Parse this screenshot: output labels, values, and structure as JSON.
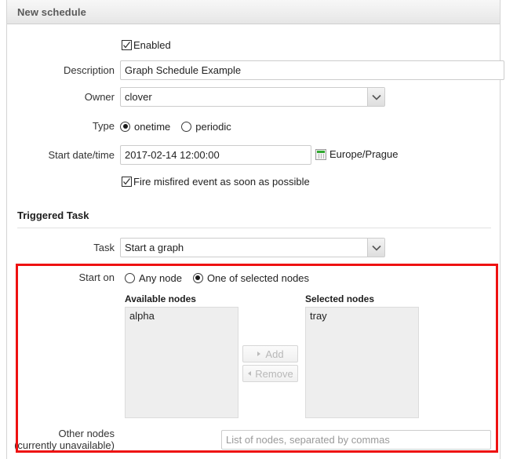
{
  "panel": {
    "title": "New schedule"
  },
  "form": {
    "enabled": {
      "label": "Enabled",
      "checked": true
    },
    "description": {
      "label": "Description",
      "value": "Graph Schedule Example",
      "placeholder": ""
    },
    "owner": {
      "label": "Owner",
      "value": "clover"
    },
    "type": {
      "label": "Type",
      "options": [
        {
          "label": "onetime",
          "selected": true
        },
        {
          "label": "periodic",
          "selected": false
        }
      ]
    },
    "start_datetime": {
      "label": "Start date/time",
      "value": "2017-02-14 12:00:00",
      "timezone": "Europe/Prague"
    },
    "fire_misfired": {
      "label": "Fire misfired event as soon as possible",
      "checked": true
    }
  },
  "triggered_task": {
    "section_title": "Triggered Task",
    "task": {
      "label": "Task",
      "value": "Start a graph"
    },
    "start_on": {
      "label": "Start on",
      "options": [
        {
          "label": "Any node",
          "selected": false
        },
        {
          "label": "One of selected nodes",
          "selected": true
        }
      ]
    },
    "available_nodes": {
      "title": "Available nodes",
      "items": [
        "alpha"
      ]
    },
    "selected_nodes": {
      "title": "Selected nodes",
      "items": [
        "tray"
      ]
    },
    "transfer_buttons": {
      "add": "Add",
      "remove": "Remove"
    },
    "other_nodes": {
      "label_line1": "Other nodes",
      "label_line2": "(currently unavailable)",
      "value": "",
      "placeholder": "List of nodes, separated by commas"
    }
  },
  "colors": {
    "highlight": "#ee1111",
    "accent_green": "#2fa82f",
    "header_text": "#5a5a5a"
  }
}
